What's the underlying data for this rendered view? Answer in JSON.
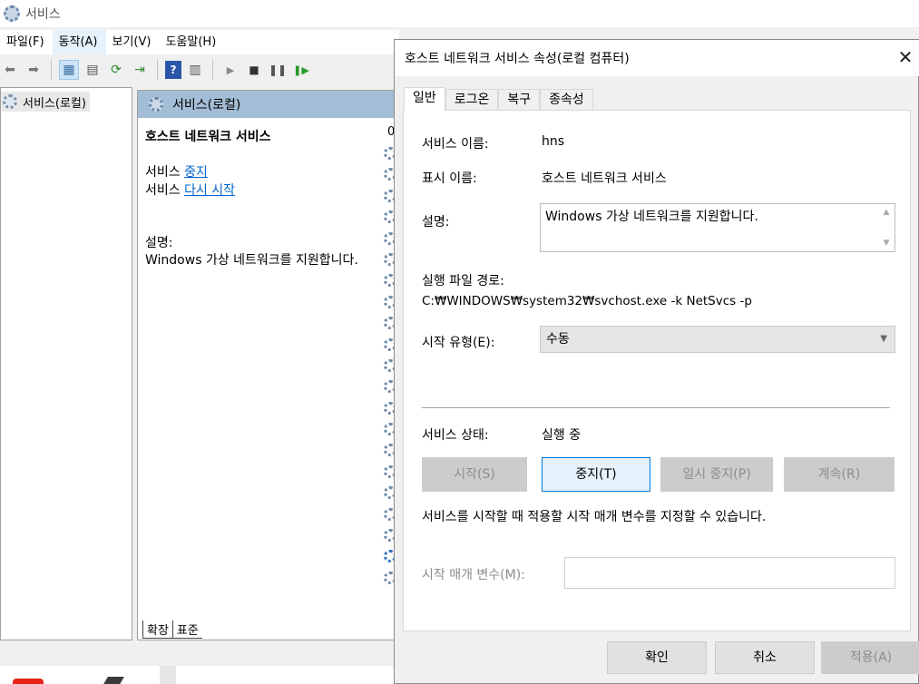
{
  "services_window": {
    "title": "서비스",
    "menu": [
      {
        "label": "파일(F)"
      },
      {
        "label": "동작(A)"
      },
      {
        "label": "보기(V)"
      },
      {
        "label": "도움말(H)"
      }
    ],
    "tree_item": "서비스(로컬)",
    "pane_header": "서비스(로컬)",
    "selected_service": "호스트 네트워크 서비스",
    "stop_prefix": "서비스 ",
    "stop_link": "중지",
    "restart_prefix": "서비스 ",
    "restart_link": "다시 시작",
    "description_label": "설명:",
    "description_text": "Windows 가상 네트워크를 지원합니다.",
    "column_peek": "0",
    "bottom_tabs": [
      "확장",
      "표준"
    ]
  },
  "dialog": {
    "title": "호스트 네트워크 서비스 속성(로컬 컴퓨터)",
    "close_glyph": "✕",
    "tabs": [
      "일반",
      "로그온",
      "복구",
      "종속성"
    ],
    "service_name_label": "서비스 이름:",
    "service_name": "hns",
    "display_name_label": "표시 이름:",
    "display_name": "호스트 네트워크 서비스",
    "description_label": "설명:",
    "description": "Windows 가상 네트워크를 지원합니다.",
    "exe_path_label": "실행 파일 경로:",
    "exe_path": "C:₩WINDOWS₩system32₩svchost.exe -k NetSvcs -p",
    "startup_type_label": "시작 유형(E):",
    "startup_type": "수동",
    "status_label": "서비스 상태:",
    "status_value": "실행 중",
    "buttons": {
      "start": "시작(S)",
      "stop": "중지(T)",
      "pause": "일시 중지(P)",
      "resume": "계속(R)"
    },
    "hint": "서비스를 시작할 때 적용할 시작 매개 변수를 지정할 수 있습니다.",
    "param_label": "시작 매개 변수(M):",
    "param_value": "",
    "footer": {
      "ok": "확인",
      "cancel": "취소",
      "apply": "적용(A)"
    }
  },
  "icons": {
    "back": "arrow-left-icon",
    "forward": "arrow-right-icon",
    "play": "play-icon",
    "stop": "stop-icon",
    "pause": "pause-icon",
    "resume": "resume-icon"
  }
}
